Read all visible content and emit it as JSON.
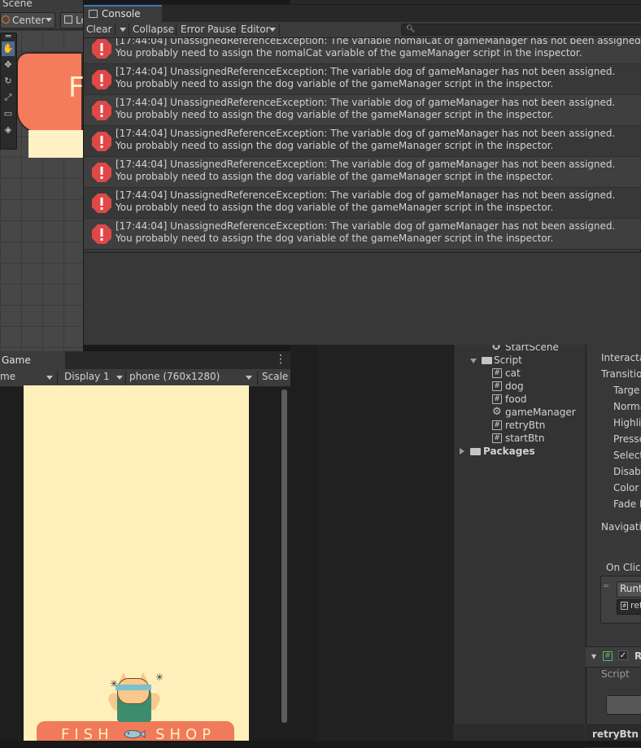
{
  "scene": {
    "tab_label": "Scene",
    "pivot_label": "Center",
    "handle_label": "Lo",
    "sprite_text": "F"
  },
  "console": {
    "tab_label": "Console",
    "toolbar": {
      "clear": "Clear",
      "collapse": "Collapse",
      "error_pause": "Error Pause",
      "editor": "Editor"
    },
    "search_placeholder": "",
    "logs": [
      {
        "line1": "[17:44:04] UnassignedReferenceException: The variable nomalCat of gameManager has not been assigned.",
        "line2": "You probably need to assign the nomalCat variable of the gameManager script in the inspector."
      },
      {
        "line1": "[17:44:04] UnassignedReferenceException: The variable dog of gameManager has not been assigned.",
        "line2": "You probably need to assign the dog variable of the gameManager script in the inspector."
      },
      {
        "line1": "[17:44:04] UnassignedReferenceException: The variable dog of gameManager has not been assigned.",
        "line2": "You probably need to assign the dog variable of the gameManager script in the inspector."
      },
      {
        "line1": "[17:44:04] UnassignedReferenceException: The variable dog of gameManager has not been assigned.",
        "line2": "You probably need to assign the dog variable of the gameManager script in the inspector."
      },
      {
        "line1": "[17:44:04] UnassignedReferenceException: The variable dog of gameManager has not been assigned.",
        "line2": "You probably need to assign the dog variable of the gameManager script in the inspector."
      },
      {
        "line1": "[17:44:04] UnassignedReferenceException: The variable dog of gameManager has not been assigned.",
        "line2": "You probably need to assign the dog variable of the gameManager script in the inspector."
      },
      {
        "line1": "[17:44:04] UnassignedReferenceException: The variable dog of gameManager has not been assigned.",
        "line2": "You probably need to assign the dog variable of the gameManager script in the inspector."
      }
    ],
    "error_color": "#e04848"
  },
  "game": {
    "tab_label": "Game",
    "mode_label": "me",
    "display_label": "Display 1",
    "resolution_label": "phone (760x1280)",
    "scale_label": "Scale",
    "shop_text": "FISH",
    "shop_text2": "SHOP",
    "background_color": "#fff0bb",
    "awning_color": "#f07a5a"
  },
  "project": {
    "items": [
      {
        "label": "StartScene",
        "icon": "unity-scene-icon"
      },
      {
        "label": "Script",
        "icon": "folder-icon"
      },
      {
        "label": "cat",
        "icon": "script-icon"
      },
      {
        "label": "dog",
        "icon": "script-icon"
      },
      {
        "label": "food",
        "icon": "script-icon"
      },
      {
        "label": "gameManager",
        "icon": "gear-icon"
      },
      {
        "label": "retryBtn",
        "icon": "script-icon"
      },
      {
        "label": "startBtn",
        "icon": "script-icon"
      },
      {
        "label": "Packages",
        "icon": "folder-icon"
      }
    ]
  },
  "inspector": {
    "interactable": "Interacta",
    "transition": "Transitio",
    "target": "Targe",
    "normal": "Norma",
    "highlighted": "Highli",
    "pressed": "Presse",
    "selected": "Select",
    "disabled": "Disab",
    "color": "Color",
    "fade": "Fade D",
    "navigation": "Navigatio",
    "on_click": "On Clic",
    "runtime": "Runt",
    "object_ref": "ret",
    "component": "R",
    "script_label": "Script",
    "footer_label": "retryBtn"
  }
}
